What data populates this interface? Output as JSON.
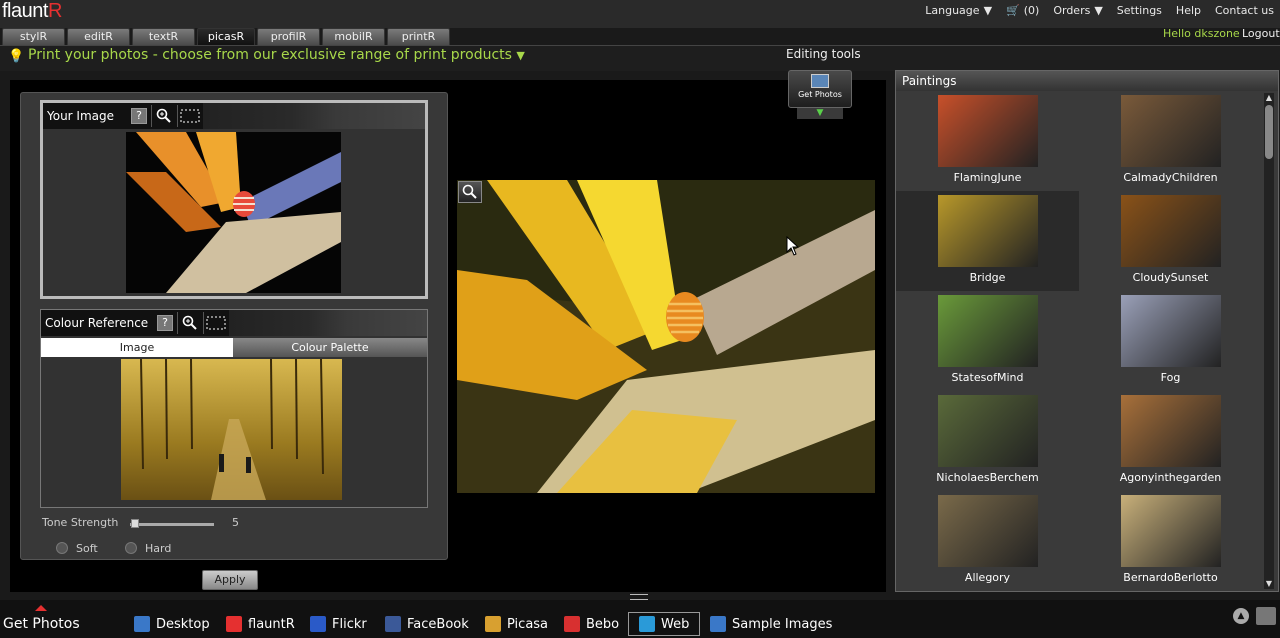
{
  "brand": {
    "name_a": "flaunt",
    "name_b": "R"
  },
  "topnav": {
    "language": "Language",
    "cart": "(0)",
    "orders": "Orders",
    "settings": "Settings",
    "help": "Help",
    "contact": "Contact us",
    "hello": "Hello dkszone",
    "logout": "Logout"
  },
  "tabs": [
    "stylR",
    "editR",
    "textR",
    "picasR",
    "profilR",
    "mobilR",
    "printR"
  ],
  "active_tab": "picasR",
  "tagline": "Print your photos - choose from our exclusive range of print products",
  "editing_tools": {
    "label": "Editing tools",
    "get_photos": "Get Photos"
  },
  "your_image": {
    "title": "Your Image",
    "help": "?"
  },
  "colour_reference": {
    "title": "Colour Reference",
    "help": "?",
    "tab_image": "Image",
    "tab_palette": "Colour Palette"
  },
  "tone": {
    "label": "Tone Strength",
    "value": "5",
    "soft": "Soft",
    "hard": "Hard"
  },
  "apply": "Apply",
  "paintings": {
    "title": "Paintings",
    "items": [
      {
        "name": "FlamingJune",
        "color": "#c8502a"
      },
      {
        "name": "CalmadyChildren",
        "color": "#7a5a3a"
      },
      {
        "name": "Bridge",
        "color": "#b8982a"
      },
      {
        "name": "CloudySunset",
        "color": "#8a5218"
      },
      {
        "name": "StatesofMind",
        "color": "#6a9a3a"
      },
      {
        "name": "Fog",
        "color": "#9aa0b8"
      },
      {
        "name": "NicholaesBerchem",
        "color": "#5a6a3a"
      },
      {
        "name": "Agonyinthegarden",
        "color": "#a8703a"
      },
      {
        "name": "Allegory",
        "color": "#7a6a4a"
      },
      {
        "name": "BernardoBerlotto",
        "color": "#c8b07a"
      }
    ],
    "selected": "Bridge"
  },
  "bottom": {
    "title": "Get Photos",
    "items": [
      {
        "label": "Desktop",
        "color": "#3a78c8"
      },
      {
        "label": "flauntR",
        "color": "#e53030"
      },
      {
        "label": "Flickr",
        "color": "#2a5ac8"
      },
      {
        "label": "FaceBook",
        "color": "#3b5998"
      },
      {
        "label": "Picasa",
        "color": "#d8a030"
      },
      {
        "label": "Bebo",
        "color": "#d83030"
      },
      {
        "label": "Web",
        "color": "#2a9ad8"
      },
      {
        "label": "Sample Images",
        "color": "#3a78c8"
      }
    ],
    "selected": "Web"
  }
}
